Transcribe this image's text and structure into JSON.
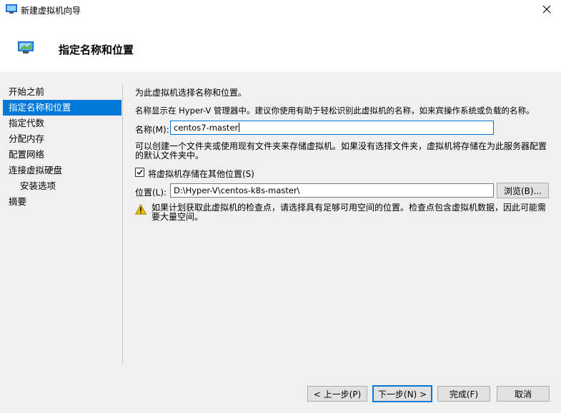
{
  "window": {
    "title": "新建虚拟机向导",
    "page_title": "指定名称和位置"
  },
  "nav": {
    "items": [
      {
        "label": "开始之前",
        "active": false,
        "sub": false
      },
      {
        "label": "指定名称和位置",
        "active": true,
        "sub": false
      },
      {
        "label": "指定代数",
        "active": false,
        "sub": false
      },
      {
        "label": "分配内存",
        "active": false,
        "sub": false
      },
      {
        "label": "配置网络",
        "active": false,
        "sub": false
      },
      {
        "label": "连接虚拟硬盘",
        "active": false,
        "sub": false
      },
      {
        "label": "安装选项",
        "active": false,
        "sub": true
      },
      {
        "label": "摘要",
        "active": false,
        "sub": false
      }
    ]
  },
  "main": {
    "intro": "为此虚拟机选择名称和位置。",
    "name_desc": "名称显示在 Hyper-V 管理器中。建议你使用有助于轻松识别此虚拟机的名称，如来宾操作系统或负载的名称。",
    "name_label": "名称(M):",
    "name_value": "centos7-master",
    "folder_desc": "可以创建一个文件夹或使用现有文件夹来存储虚拟机。如果没有选择文件夹，虚拟机将存储在为此服务器配置的默认文件夹中。",
    "store_checkbox_label": "将虚拟机存储在其他位置(S)",
    "store_checked": true,
    "location_label": "位置(L):",
    "location_value": "D:\\Hyper-V\\centos-k8s-master\\",
    "browse_label": "浏览(B)...",
    "warning": "如果计划获取此虚拟机的检查点，请选择具有足够可用空间的位置。检查点包含虚拟机数据，因此可能需要大量空间。"
  },
  "footer": {
    "prev_label": "< 上一步(P)",
    "next_label": "下一步(N) >",
    "finish_label": "完成(F)",
    "cancel_label": "取消"
  },
  "colors": {
    "accent": "#0078d7",
    "warning": "#f2c200"
  }
}
